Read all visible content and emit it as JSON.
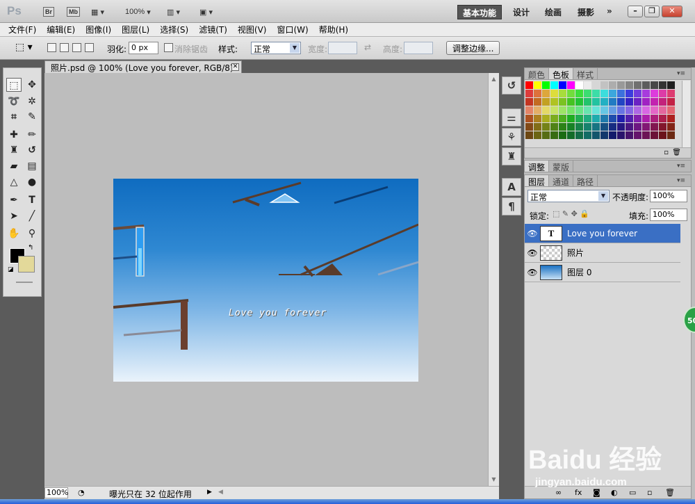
{
  "appbar": {
    "logo": "Ps",
    "bridge": "Br",
    "minibridge": "Mb",
    "zoom": "100%",
    "workspaces": [
      "基本功能",
      "设计",
      "绘画",
      "摄影"
    ],
    "more": "»"
  },
  "menu": [
    "文件(F)",
    "编辑(E)",
    "图像(I)",
    "图层(L)",
    "选择(S)",
    "滤镜(T)",
    "视图(V)",
    "窗口(W)",
    "帮助(H)"
  ],
  "options": {
    "feather_label": "羽化:",
    "feather_value": "0 px",
    "antialias_label": "消除锯齿",
    "style_label": "样式:",
    "style_value": "正常",
    "width_label": "宽度:",
    "height_label": "高度:",
    "refine_button": "调整边缘..."
  },
  "document": {
    "tab_title": "照片.psd @ 100% (Love you forever, RGB/8) *",
    "canvas_text": "Love you forever",
    "status_zoom": "100%",
    "status_text": "曝光只在 32 位起作用"
  },
  "panels": {
    "swatch_tabs": [
      "颜色",
      "色板",
      "样式"
    ],
    "adjust_tabs": [
      "调整",
      "蒙版"
    ],
    "layer_tabs": [
      "图层",
      "通道",
      "路径"
    ],
    "blend_mode": "正常",
    "opacity_label": "不透明度:",
    "opacity_value": "100%",
    "lock_label": "锁定:",
    "fill_label": "填充:",
    "fill_value": "100%",
    "layers": [
      {
        "name": "Love you forever",
        "thumb": "T",
        "selected": true
      },
      {
        "name": "照片",
        "thumb": "checker",
        "selected": false
      },
      {
        "name": "图层 0",
        "thumb": "gradient",
        "selected": false
      }
    ]
  },
  "watermark": {
    "brand": "Baidu 经验",
    "url": "jingyan.baidu.com"
  },
  "badge": "50",
  "colors": {
    "foreground": "#000000",
    "background": "#e3d99a",
    "selection": "#3a6fc4"
  }
}
